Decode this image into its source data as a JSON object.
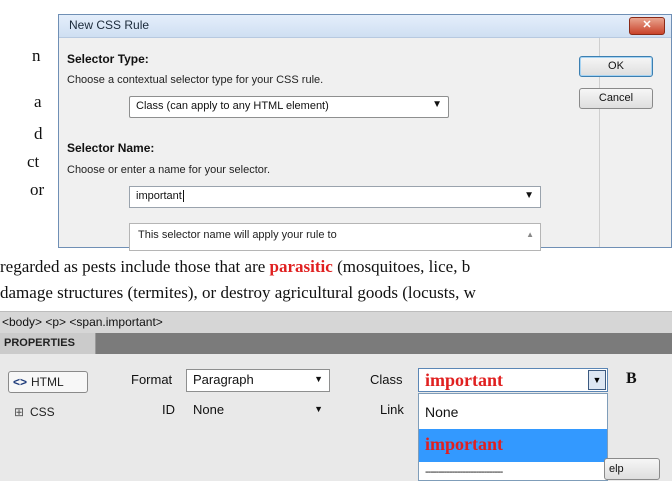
{
  "background_fragments": [
    "n",
    "a",
    "d",
    "ct",
    "or"
  ],
  "dialog": {
    "title": "New CSS Rule",
    "close_glyph": "✕",
    "selector_type": {
      "heading": "Selector Type:",
      "description": "Choose a contextual selector type for your CSS rule.",
      "value": "Class (can apply to any HTML element)"
    },
    "selector_name": {
      "heading": "Selector Name:",
      "description": "Choose or enter a name for your selector.",
      "value": "important",
      "info": "This selector name will apply your rule to"
    },
    "ok_label": "OK",
    "cancel_label": "Cancel"
  },
  "prose": {
    "line1_before": "regarded as pests include those that are ",
    "line1_highlight": "parasitic",
    "line1_after": " (mosquitoes, lice, b",
    "line2": "damage structures (termites), or destroy agricultural goods (locusts, w"
  },
  "tag_selector": "<body> <p> <span.important>",
  "properties": {
    "tab_label": "PROPERTIES",
    "html_mode_label": "HTML",
    "css_mode_label": "CSS",
    "format_label": "Format",
    "format_value": "Paragraph",
    "id_label": "ID",
    "id_value": "None",
    "class_label": "Class",
    "class_value": "important",
    "link_label": "Link",
    "bold_label": "B",
    "class_options": [
      "None",
      "important",
      "-----------------------------"
    ],
    "help_label": "elp"
  },
  "colors": {
    "highlight_text": "#e02020",
    "selected_item_bg": "#3399ff"
  }
}
